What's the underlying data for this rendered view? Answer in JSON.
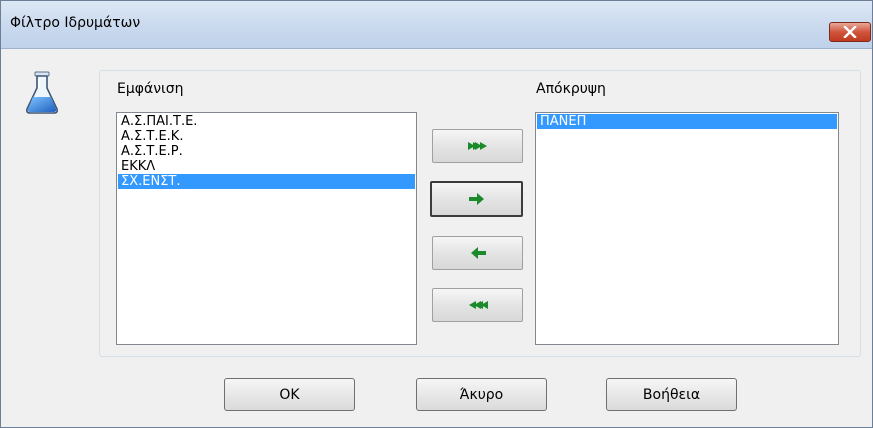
{
  "window": {
    "title": "Φίλτρο Ιδρυμάτων",
    "close_icon": "close-icon",
    "accent_color": "#c0391f"
  },
  "app_icon": "flask-icon",
  "show_list": {
    "label": "Εμφάνιση",
    "items": [
      "Α.Σ.ΠΑΙ.Τ.Ε.",
      "Α.Σ.Τ.Ε.Κ.",
      "Α.Σ.Τ.Ε.Ρ.",
      "ΕΚΚΛ",
      "ΣΧ.ΕΝΣΤ."
    ],
    "selected": "ΣΧ.ΕΝΣΤ."
  },
  "hide_list": {
    "label": "Απόκρυψη",
    "items": [
      "ΠΑΝΕΠ"
    ],
    "selected": "ΠΑΝΕΠ"
  },
  "move_buttons": [
    {
      "action": "move-all-right",
      "icon": "double-arrow-right-icon"
    },
    {
      "action": "move-selected-right",
      "icon": "arrow-right-icon"
    },
    {
      "action": "move-selected-left",
      "icon": "arrow-left-icon"
    },
    {
      "action": "move-all-left",
      "icon": "double-arrow-left-icon"
    }
  ],
  "buttons": {
    "ok": "OK",
    "cancel": "Άκυρο",
    "help": "Βοήθεια"
  },
  "colors": {
    "selection": "#3399ff",
    "arrow_green": "#1a8a2a"
  }
}
